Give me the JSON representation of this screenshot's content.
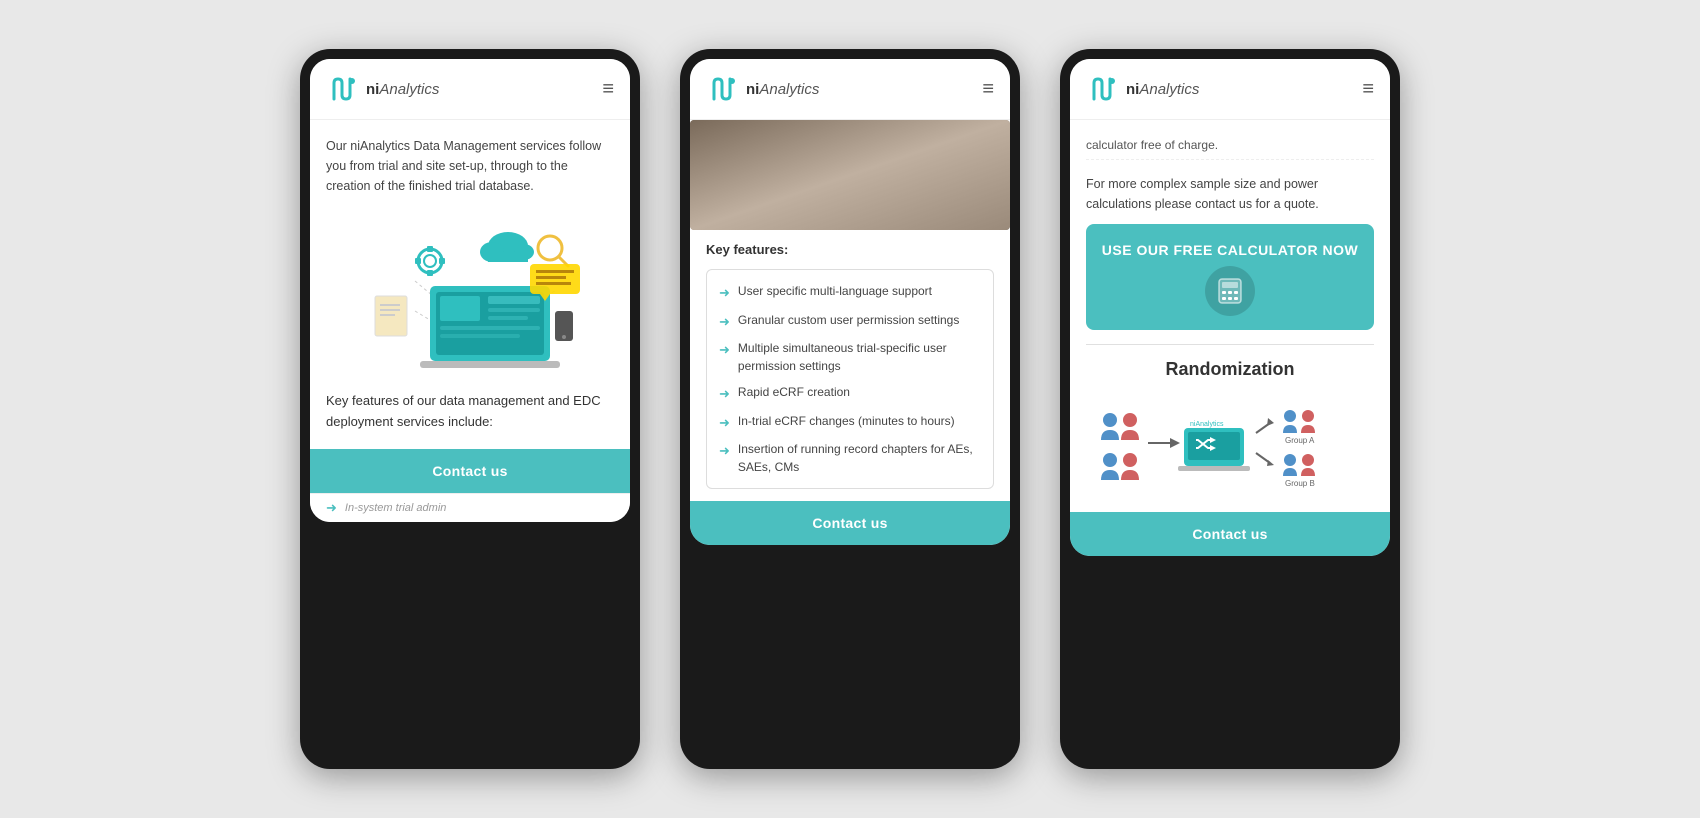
{
  "brand": {
    "name_prefix": "ni",
    "name_suffix": "Analytics"
  },
  "phone1": {
    "nav_menu": "≡",
    "body_text": "Our niAnalytics Data Management services follow you from trial and site set-up, through to the creation of the finished trial database.",
    "section_label": "Key features of our data management and EDC deployment services include:",
    "contact_button": "Contact us",
    "partial_bottom": "In-system trial admin"
  },
  "phone2": {
    "nav_menu": "≡",
    "key_features_label": "Key features:",
    "features": [
      "User specific multi-language support",
      "Granular custom user permission settings",
      "Multiple simultaneous trial-specific user permission settings",
      "Rapid eCRF creation",
      "In-trial eCRF changes (minutes to hours)",
      "Insertion of running record chapters for AEs, SAEs, CMs"
    ],
    "contact_button": "Contact us"
  },
  "phone3": {
    "nav_menu": "≡",
    "top_text1": "calculator free of charge.",
    "top_text2": "For more complex sample size and power calculations please contact us for a quote.",
    "cta_button": "USE OUR FREE CALCULATOR NOW",
    "randomization_title": "Randomization",
    "group_a_label": "Group A",
    "group_b_label": "Group B",
    "contact_button": "Contact us"
  },
  "icons": {
    "hamburger": "≡",
    "arrow": "➜",
    "calculator": "🖩"
  },
  "colors": {
    "teal": "#4bbfbf",
    "dark": "#1a1a1a",
    "text": "#444444"
  }
}
